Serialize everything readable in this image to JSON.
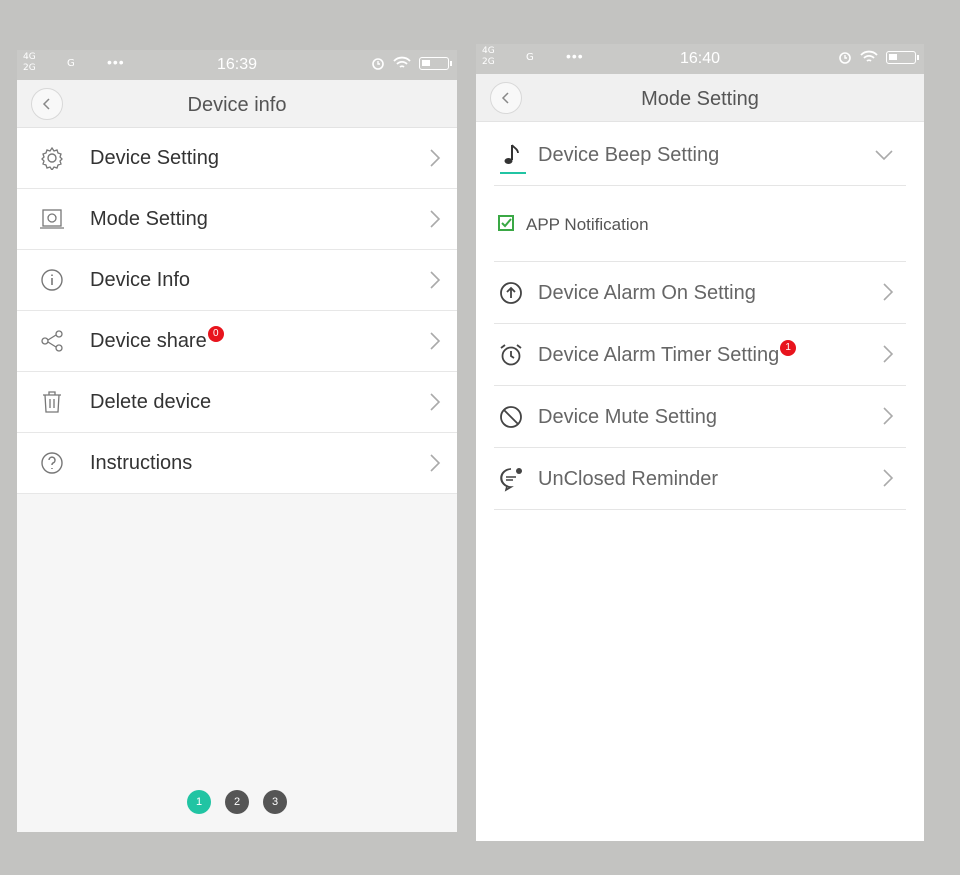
{
  "left_phone": {
    "status": {
      "network_top": "4G",
      "network_bottom": "2G",
      "network_g": "G",
      "dots": "•••",
      "time": "16:39"
    },
    "header": {
      "title": "Device info"
    },
    "menu": [
      {
        "label": "Device Setting",
        "icon": "gear-icon",
        "badge": null
      },
      {
        "label": "Mode Setting",
        "icon": "device-icon",
        "badge": null
      },
      {
        "label": "Device Info",
        "icon": "info-icon",
        "badge": null
      },
      {
        "label": "Device share",
        "icon": "share-icon",
        "badge": "0"
      },
      {
        "label": "Delete device",
        "icon": "trash-icon",
        "badge": null
      },
      {
        "label": "Instructions",
        "icon": "question-icon",
        "badge": null
      }
    ],
    "pager": {
      "pages": [
        "1",
        "2",
        "3"
      ],
      "active": "1"
    }
  },
  "right_phone": {
    "status": {
      "network_top": "4G",
      "network_bottom": "2G",
      "network_g": "G",
      "dots": "•••",
      "time": "16:40"
    },
    "header": {
      "title": "Mode Setting"
    },
    "beep": {
      "label": "Device Beep Setting",
      "icon": "music-note-icon"
    },
    "notification": {
      "label": "APP Notification",
      "checked": true
    },
    "items": [
      {
        "label": "Device Alarm On Setting",
        "icon": "arrow-up-circle-icon",
        "badge": null
      },
      {
        "label": "Device Alarm Timer Setting",
        "icon": "alarm-clock-icon",
        "badge": "1"
      },
      {
        "label": "Device Mute Setting",
        "icon": "no-entry-icon",
        "badge": null
      },
      {
        "label": "UnClosed Reminder",
        "icon": "message-icon",
        "badge": null
      }
    ]
  },
  "colors": {
    "accent": "#21c4a3",
    "badge": "#e8141d",
    "check": "#3aa845"
  }
}
